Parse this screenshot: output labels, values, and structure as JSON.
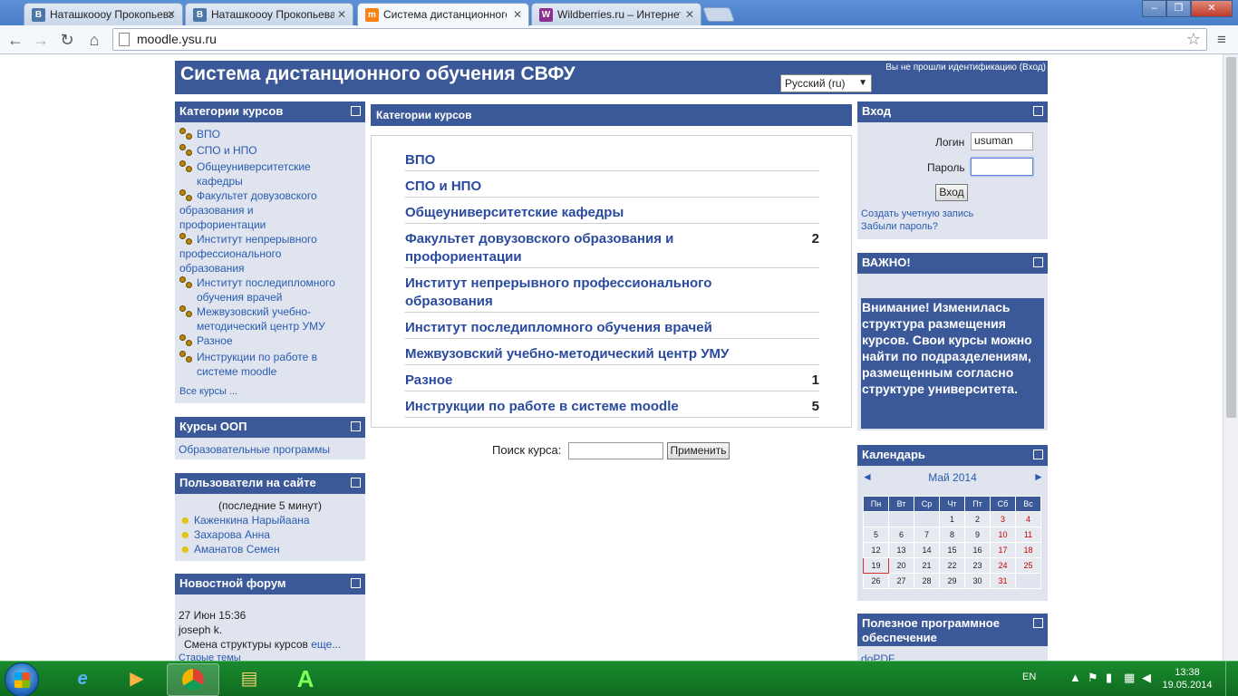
{
  "browser": {
    "tabs": [
      {
        "title": "Наташкоооу Прокопьева",
        "favicon": "vk-icon",
        "fav_text": "B",
        "fav_color": "#4a76a8"
      },
      {
        "title": "Наташкоооу Прокопьева",
        "favicon": "vk-icon",
        "fav_text": "B",
        "fav_color": "#4a76a8"
      },
      {
        "title": "Система дистанционного",
        "favicon": "moodle-icon",
        "fav_text": "m",
        "fav_color": "#f98012"
      },
      {
        "title": "Wildberries.ru – Интернет",
        "favicon": "wildberries-icon",
        "fav_text": "W",
        "fav_color": "#8b2e8e"
      }
    ],
    "url": "moodle.ysu.ru"
  },
  "header": {
    "title": "Система дистанционного обучения СВФУ",
    "login_info_prefix": "Вы не прошли идентификацию (",
    "login_link": "Вход",
    "login_info_suffix": ")",
    "language": "Русский (ru)"
  },
  "left": {
    "categories": {
      "title": "Категории курсов",
      "items": [
        {
          "label": "ВПО"
        },
        {
          "label": "СПО и НПО"
        },
        {
          "label": "Общеуниверситетские кафедры"
        },
        {
          "label": "Факультет довузовского образования и профориентации"
        },
        {
          "label": "Институт непрерывного профессионального образования"
        },
        {
          "label": "Институт последипломного обучения врачей"
        },
        {
          "label": "Межвузовский учебно-методический центр УМУ"
        },
        {
          "label": "Разное"
        },
        {
          "label": "Инструкции по работе в системе moodle"
        }
      ],
      "all_courses": "Все курсы ..."
    },
    "oop": {
      "title": "Курсы ООП",
      "link": "Образовательные программы"
    },
    "online": {
      "title": "Пользователи на сайте",
      "subtitle": "(последние 5 минут)",
      "users": [
        "Каженкина Нарыйаана",
        "Захарова Анна",
        "Аманатов Семен"
      ]
    },
    "news": {
      "title": "Новостной форум",
      "date": "27 Июн 15:36",
      "author": "joseph k.",
      "text": "Смена структуры курсов",
      "more": "еще...",
      "old": "Старые темы"
    }
  },
  "center": {
    "title": "Категории курсов",
    "rows": [
      {
        "label": "ВПО",
        "count": ""
      },
      {
        "label": "СПО и НПО",
        "count": ""
      },
      {
        "label": "Общеуниверситетские кафедры",
        "count": ""
      },
      {
        "label": "Факультет довузовского образования и профориентации",
        "count": "2"
      },
      {
        "label": "Институт непрерывного профессионального образования",
        "count": ""
      },
      {
        "label": "Институт последипломного обучения врачей",
        "count": ""
      },
      {
        "label": "Межвузовский учебно-методический центр УМУ",
        "count": ""
      },
      {
        "label": "Разное",
        "count": "1"
      },
      {
        "label": "Инструкции по работе в системе moodle",
        "count": "5"
      }
    ],
    "search_label": "Поиск курса:",
    "search_button": "Применить"
  },
  "right": {
    "login": {
      "title": "Вход",
      "login_label": "Логин",
      "login_value": "usuman",
      "password_label": "Пароль",
      "submit": "Вход",
      "create_account": "Создать учетную запись",
      "forgot": "Забыли пароль?"
    },
    "important": {
      "title": "ВАЖНО!",
      "text": "Внимание! Изменилась структура размещения курсов. Свои курсы можно найти по подразделениям, размещенным согласно структуре университета."
    },
    "calendar": {
      "title": "Календарь",
      "month": "Май 2014",
      "weekdays": [
        "Пн",
        "Вт",
        "Ср",
        "Чт",
        "Пт",
        "Сб",
        "Вс"
      ],
      "weeks": [
        [
          "",
          "",
          "",
          "1",
          "2",
          "3",
          "4"
        ],
        [
          "5",
          "6",
          "7",
          "8",
          "9",
          "10",
          "11"
        ],
        [
          "12",
          "13",
          "14",
          "15",
          "16",
          "17",
          "18"
        ],
        [
          "19",
          "20",
          "21",
          "22",
          "23",
          "24",
          "25"
        ],
        [
          "26",
          "27",
          "28",
          "29",
          "30",
          "31",
          ""
        ]
      ],
      "today": "19"
    },
    "software": {
      "title": "Полезное программное обеспечение",
      "item": "doPDF"
    }
  },
  "taskbar": {
    "lang": "EN",
    "time": "13:38",
    "date": "19.05.2014"
  },
  "colors": {
    "header_blue": "#3b5998",
    "block_bg": "#dfe4ee",
    "link": "#2a5bb0",
    "taskbar": "#127a28"
  }
}
